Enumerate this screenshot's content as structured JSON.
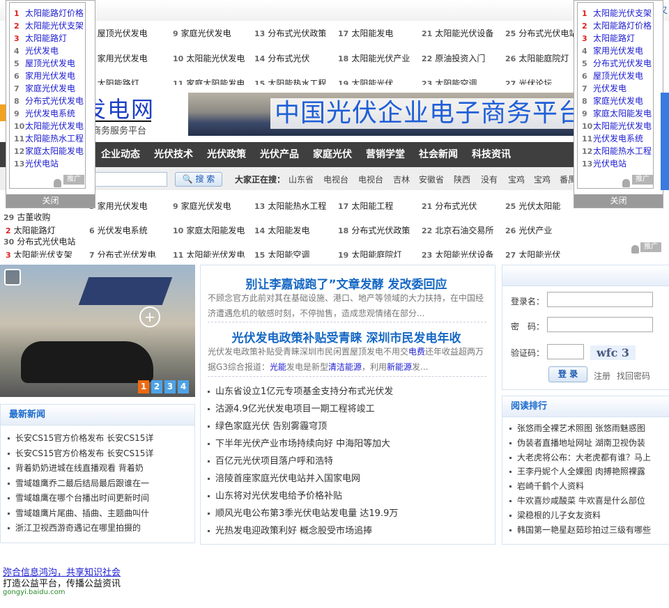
{
  "top_corner_text": "又",
  "keywords_top": [
    [
      5,
      "屋顶光伏发电"
    ],
    [
      9,
      "家庭光伏发电"
    ],
    [
      13,
      "分布式光伏政策"
    ],
    [
      17,
      "太阳能发电"
    ],
    [
      21,
      "太阳能光伏设备"
    ],
    [
      25,
      "分布式光伏电站"
    ],
    [
      6,
      "家用光伏发电"
    ],
    [
      10,
      "太阳能光伏发电"
    ],
    [
      14,
      "分布式光伏"
    ],
    [
      18,
      "太阳能光伏产业"
    ],
    [
      22,
      "原油投资入门"
    ],
    [
      26,
      "太阳能庭院灯"
    ],
    [
      7,
      "太阳能路灯"
    ],
    [
      11,
      "家庭太阳能发电"
    ],
    [
      15,
      "太阳能热水工程"
    ],
    [
      19,
      "太阳能光伏"
    ],
    [
      23,
      "太阳能空调"
    ],
    [
      27,
      "光伏论坛"
    ]
  ],
  "logo": {
    "title": "发电网",
    "subtitle": "商务服务平台"
  },
  "banner": {
    "title": "中国光伏企业电子商务平台"
  },
  "nav": [
    "企业动态",
    "光伏技术",
    "光伏政策",
    "光伏产品",
    "家庭光伏",
    "营销学堂",
    "社会新闻",
    "科技资讯"
  ],
  "search": {
    "button": "搜 索",
    "hot_label": "大家正在搜：",
    "hot_words": [
      "山东省",
      "电视台",
      "电视台",
      "吉林",
      "安徽省",
      "陕西",
      "没有",
      "宝鸡",
      "宝鸡",
      "番禺"
    ]
  },
  "left_float": {
    "items": [
      "太阳能路灯价格",
      "太阳能光伏支架",
      "太阳能路灯",
      "光伏发电",
      "屋顶光伏发电",
      "家用光伏发电",
      "家庭光伏发电",
      "分布式光伏发电",
      "光伏发电系统",
      "太阳能光伏发电",
      "太阳能热水工程",
      "家庭太阳能发电",
      "光伏电站"
    ],
    "ad": "推广",
    "close": "关闭"
  },
  "right_float": {
    "items": [
      "太阳能光伏支架",
      "太阳能路灯价格",
      "太阳能路灯",
      "家用光伏发电",
      "分布式光伏发电",
      "屋顶光伏发电",
      "光伏发电",
      "家庭光伏发电",
      "家庭太阳能发电",
      "太阳能光伏发电",
      "光伏发电系统",
      "太阳能热水工程",
      "光伏电站"
    ],
    "ad": "推广",
    "close": "关闭"
  },
  "keywords_bottom": {
    "row1": [
      [
        5,
        "家用光伏发电"
      ],
      [
        9,
        "家庭光伏发电"
      ],
      [
        13,
        "太阳能热水工程"
      ],
      [
        17,
        "太阳能工程"
      ],
      [
        21,
        "分布式光伏"
      ],
      [
        25,
        "光伏太阳能"
      ]
    ],
    "row1b": [
      29,
      "古董收购"
    ],
    "row2": [
      [
        2,
        "太阳能路灯"
      ],
      [
        6,
        "光伏发电系统"
      ],
      [
        10,
        "家庭太阳能发电"
      ],
      [
        14,
        "太阳能发电"
      ],
      [
        18,
        "分布式光伏政策"
      ],
      [
        22,
        "北京石油交易所"
      ],
      [
        26,
        "光伏产业"
      ]
    ],
    "row2b": [
      30,
      "分布式光伏电站"
    ],
    "row3": [
      [
        3,
        "太阳能光伏支架"
      ],
      [
        7,
        "分布式光伏发电"
      ],
      [
        11,
        "太阳能光伏发电"
      ],
      [
        15,
        "太阳能空调"
      ],
      [
        19,
        "太阳能庭院灯"
      ],
      [
        23,
        "太阳能光伏设备"
      ],
      [
        27,
        "太阳能光伏"
      ]
    ],
    "ad": "推广"
  },
  "slideshow": {
    "pages": [
      "1",
      "2",
      "3",
      "4"
    ],
    "active": 1
  },
  "headlines": [
    {
      "title": "别让李嘉诚跑了”文章发酵 发改委回应",
      "summary": "不顾念官方此前对其在基础设施、港口、地产等领域的大力扶持，在中国经济遭遇危机的敏感时刻，不停抛售，造成悲观情绪在部分..."
    },
    {
      "title": "光伏发电政策补贴受青睐 深圳市民发电年收",
      "summary_parts": [
        "光伏发电政策补贴受青睐深圳市民闲置屋顶发电不用交",
        "电费",
        "还年收益超两万据G3综合报道：",
        "光能",
        "发电是新型",
        "清洁能源",
        "，利用",
        "新能源",
        "发..."
      ]
    }
  ],
  "center_list": [
    "山东省设立1亿元专项基金支持分布式光伏发",
    "沽源4.9亿光伏发电项目一期工程将竣工",
    "绿色家庭光伏 告别雾霾穹顶",
    "下半年光伏产业市场持续向好 中海阳等加大",
    "百亿元光伏项目落户呼和浩特",
    "涪陵首座家庭光伏电站并入国家电网",
    "山东将对光伏发电给予价格补贴",
    "顺风光电公布第3季光伏电站发电量 达19.9万",
    "光热发电迎政策利好 概念股受市场追捧"
  ],
  "latest_news": {
    "title": "最新新闻",
    "items": [
      "长安CS15官方价格发布 长安CS15详",
      "长安CS15官方价格发布 长安CS15详",
      "背着奶奶进城在线直播观看 背着奶",
      "雪域雄鹰乔二最后结局最后跟谁在一",
      "雪域雄鹰在哪个台播出时间更新时间",
      "雪域雄鹰片尾曲、插曲、主题曲叫什",
      "浙江卫视西游奇遇记在哪里拍摄的"
    ]
  },
  "login": {
    "username_label": "登录名：",
    "password_label": "密　码：",
    "captcha_label": "验证码：",
    "captcha_image_text": "wfc 3",
    "submit": "登 录",
    "register": "注册",
    "forgot": "找回密码",
    "username_value": "",
    "password_value": "",
    "captcha_value": ""
  },
  "ranking": {
    "title": "阅读排行",
    "items": [
      "张悠雨全裸艺术照图 张悠雨魅惑图",
      "伪装者直播地址网址 湖南卫视伪装",
      "大老虎将公布：大老虎都有谁？马上",
      "王李丹妮个人全婐图 肉搏艳照裸露",
      "岩崎千鹤个人资料",
      "牛欢喜炒咸酸菜 牛欢喜是什么部位",
      "梁稳根的儿子女友资料",
      "韩国第一艳星赵茹珍拍过三级有哪些"
    ]
  },
  "footer_ad": {
    "title": "弥合信息鸿沟，共享知识社会",
    "desc": "打造公益平台，传播公益资讯",
    "url": "gongyi.baidu.com"
  },
  "colors": {
    "nav_bg": "#3f3f3f",
    "link_blue": "#1a1ad0",
    "headline_blue": "#1668c4",
    "active_dot": "#f06a10"
  }
}
